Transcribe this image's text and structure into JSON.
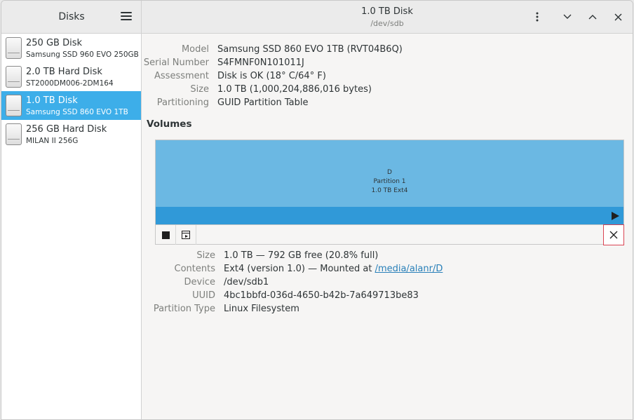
{
  "sidebar": {
    "title": "Disks",
    "menu_icon": "hamburger-menu-icon",
    "disks": [
      {
        "name": "250 GB Disk",
        "model": "Samsung SSD 960 EVO 250GB",
        "selected": false
      },
      {
        "name": "2.0 TB Hard Disk",
        "model": "ST2000DM006-2DM164",
        "selected": false
      },
      {
        "name": "1.0 TB Disk",
        "model": "Samsung SSD 860 EVO 1TB",
        "selected": true
      },
      {
        "name": "256 GB Hard Disk",
        "model": "MILAN II 256G",
        "selected": false
      }
    ]
  },
  "header": {
    "title": "1.0 TB Disk",
    "subtitle": "/dev/sdb",
    "icons": [
      "more-vertical-icon",
      "minimize-icon",
      "maximize-icon",
      "close-icon"
    ]
  },
  "drive": {
    "model_label": "Model",
    "model_value": "Samsung SSD 860 EVO 1TB (RVT04B6Q)",
    "serial_label": "Serial Number",
    "serial_value": "S4FMNF0N101011J",
    "assessment_label": "Assessment",
    "assessment_value": "Disk is OK (18° C/64° F)",
    "size_label": "Size",
    "size_value": "1.0 TB (1,000,204,886,016 bytes)",
    "partitioning_label": "Partitioning",
    "partitioning_value": "GUID Partition Table"
  },
  "volumes": {
    "title": "Volumes",
    "partition": {
      "name": "D",
      "label": "Partition 1",
      "size": "1.0 TB Ext4"
    },
    "colors": {
      "partition": "#6bb8e3",
      "bar": "#3099d8",
      "delete": "#da4453"
    }
  },
  "volume_info": {
    "size_label": "Size",
    "size_value": "1.0 TB — 792 GB free (20.8% full)",
    "contents_label": "Contents",
    "contents_prefix": "Ext4 (version 1.0) — Mounted at ",
    "contents_link": "/media/alanr/D",
    "device_label": "Device",
    "device_value": "/dev/sdb1",
    "uuid_label": "UUID",
    "uuid_value": "4bc1bbfd-036d-4650-b42b-7a649713be83",
    "ptype_label": "Partition Type",
    "ptype_value": "Linux Filesystem"
  }
}
